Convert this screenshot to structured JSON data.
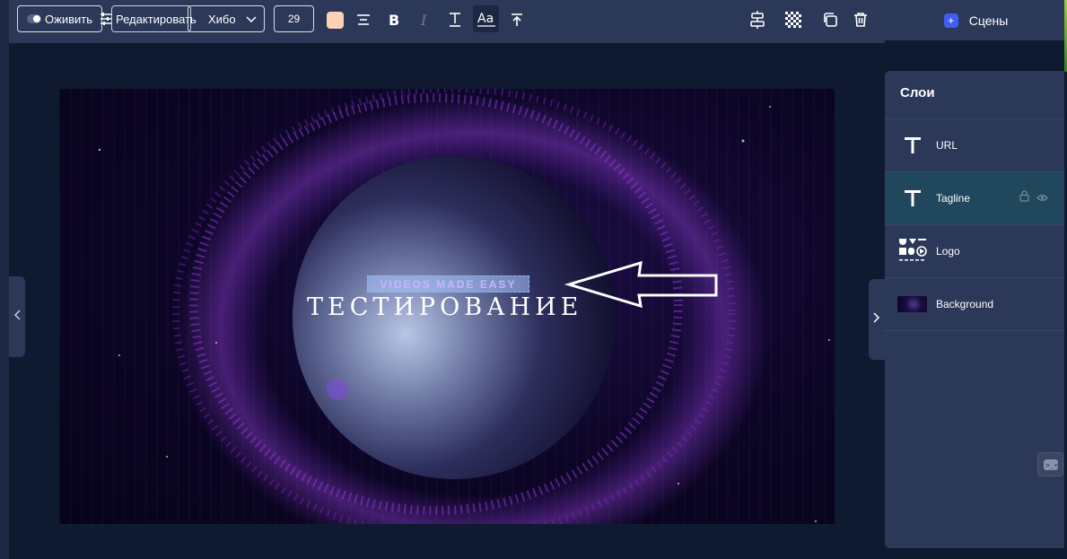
{
  "toolbar": {
    "animate_label": "Оживить",
    "edit_label": "Редактировать",
    "font_label": "Хибо",
    "font_size": "29",
    "text_color": "#fbd2b4",
    "icons": [
      "align-center-icon",
      "bold-icon",
      "italic-icon",
      "text-height-icon",
      "text-case-icon",
      "align-top-icon",
      "align-vertical-icon",
      "transparency-icon",
      "duplicate-icon",
      "trash-icon"
    ]
  },
  "scenes": {
    "label": "Сцены"
  },
  "canvas": {
    "tagline": "VIDEOS MADE EASY",
    "title": "ТЕСТИРОВАНИЕ"
  },
  "layers": {
    "title": "Слои",
    "items": [
      {
        "label": "URL",
        "icon": "text-icon"
      },
      {
        "label": "Tagline",
        "icon": "text-icon",
        "active": true
      },
      {
        "label": "Logo",
        "icon": "logo-shapes-icon"
      },
      {
        "label": "Background",
        "icon": "background-thumbnail"
      }
    ]
  },
  "colors": {
    "toolbar_bg": "#2c3858",
    "page_bg": "#0f1a30",
    "active_layer_bg": "#21475c",
    "accent": "#3d5ef0"
  }
}
